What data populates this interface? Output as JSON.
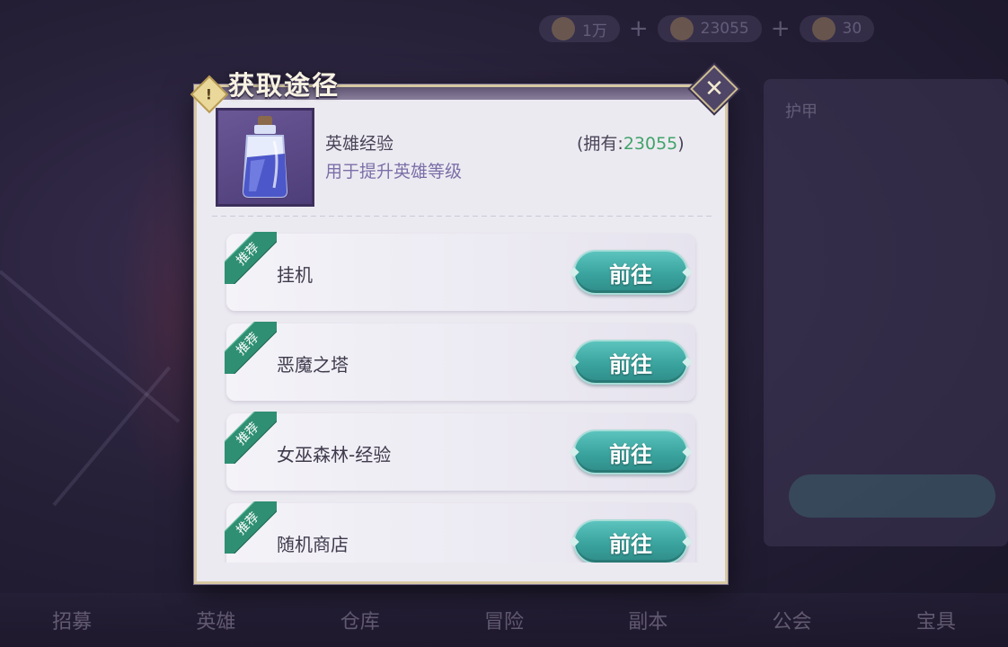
{
  "background": {
    "top_resources": [
      {
        "icon": "coin-icon",
        "value": "1万"
      },
      {
        "icon": "gem-icon",
        "value": "23055"
      },
      {
        "icon": "avatar-icon",
        "value": "30"
      }
    ],
    "side_panel_title": "护甲",
    "bottom_nav": [
      "招募",
      "英雄",
      "仓库",
      "冒险",
      "副本",
      "公会",
      "宝具"
    ]
  },
  "dialog": {
    "title": "获取途径",
    "title_badge": "!",
    "close_icon": "close-icon",
    "item": {
      "icon": "potion-bottle-icon",
      "name": "英雄经验",
      "description": "用于提升英雄等级",
      "owned_prefix": "(拥有:",
      "owned_count": "23055",
      "owned_suffix": ")"
    },
    "routes": [
      {
        "tag": "推荐",
        "label": "挂机",
        "button": "前往"
      },
      {
        "tag": "推荐",
        "label": "恶魔之塔",
        "button": "前往"
      },
      {
        "tag": "推荐",
        "label": "女巫森林-经验",
        "button": "前往"
      },
      {
        "tag": "推荐",
        "label": "随机商店",
        "button": "前往"
      }
    ]
  },
  "colors": {
    "accent_teal": "#3aa39e",
    "tag_green": "#2f8f72",
    "owned_count_green": "#41a36a",
    "dialog_bg": "#eceaf1"
  }
}
